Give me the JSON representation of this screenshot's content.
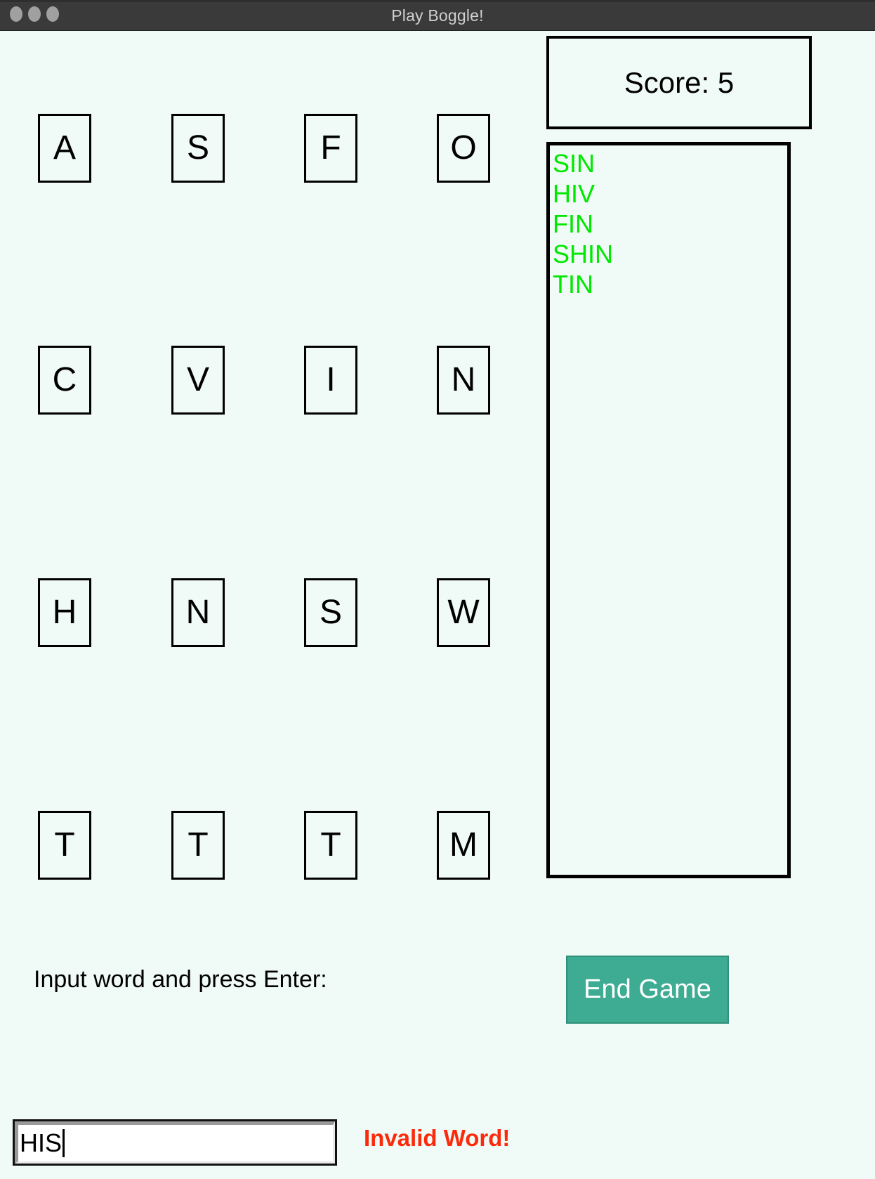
{
  "window": {
    "title": "Play Boggle!",
    "traffic_lights": [
      "close-button",
      "minimize-button",
      "zoom-button"
    ],
    "background_color": "#f0faf6",
    "titlebar_color": "#3a3a3a"
  },
  "board": {
    "rows": 4,
    "cols": 4,
    "letters": [
      [
        "A",
        "S",
        "F",
        "O"
      ],
      [
        "C",
        "V",
        "I",
        "N"
      ],
      [
        "H",
        "N",
        "S",
        "W"
      ],
      [
        "T",
        "T",
        "T",
        "M"
      ]
    ]
  },
  "score": {
    "label": "Score: 5",
    "value": 5,
    "text_color": "#000000"
  },
  "found_words": {
    "items": [
      "SIN",
      "HIV",
      "FIN",
      "SHIN",
      "TIN"
    ],
    "text_color": "#00e800"
  },
  "controls": {
    "end_game_label": "End Game",
    "end_game_color": "#3eab93"
  },
  "input": {
    "prompt": "Input word and press Enter:",
    "value": "HIS",
    "placeholder": "",
    "status_message": "Invalid Word!",
    "status_color": "#fc2a0c"
  }
}
